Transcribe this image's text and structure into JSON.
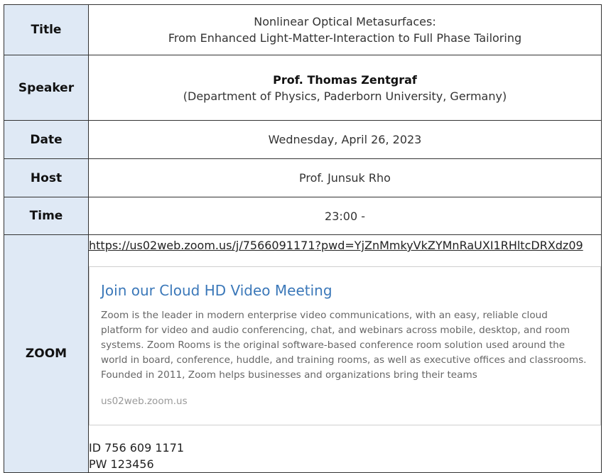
{
  "rows": {
    "title": {
      "label": "Title",
      "line1": "Nonlinear Optical Metasurfaces:",
      "line2": "From Enhanced Light-Matter-Interaction to Full Phase Tailoring"
    },
    "speaker": {
      "label": "Speaker",
      "name": "Prof. Thomas Zentgraf",
      "affiliation": "(Department of Physics, Paderborn University, Germany)"
    },
    "date": {
      "label": "Date",
      "value": "Wednesday, April 26, 2023"
    },
    "host": {
      "label": "Host",
      "value": "Prof. Junsuk Rho"
    },
    "time": {
      "label": "Time",
      "value": "23:00 -"
    },
    "zoom": {
      "label": "ZOOM",
      "link": "https://us02web.zoom.us/j/7566091171?pwd=YjZnMmkyVkZYMnRaUXI1RHltcDRXdz09",
      "card": {
        "title": "Join our Cloud HD Video Meeting",
        "description": "Zoom is the leader in modern enterprise video communications, with an easy, reliable cloud platform for video and audio conferencing, chat, and webinars across mobile, desktop, and room systems. Zoom Rooms is the original software-based conference room solution used around the world in board, conference, huddle, and training rooms, as well as executive offices and classrooms. Founded in 2011, Zoom helps businesses and organizations bring their teams",
        "site": "us02web.zoom.us"
      },
      "id": "ID 756 609 1171",
      "pw": "PW 123456"
    }
  }
}
